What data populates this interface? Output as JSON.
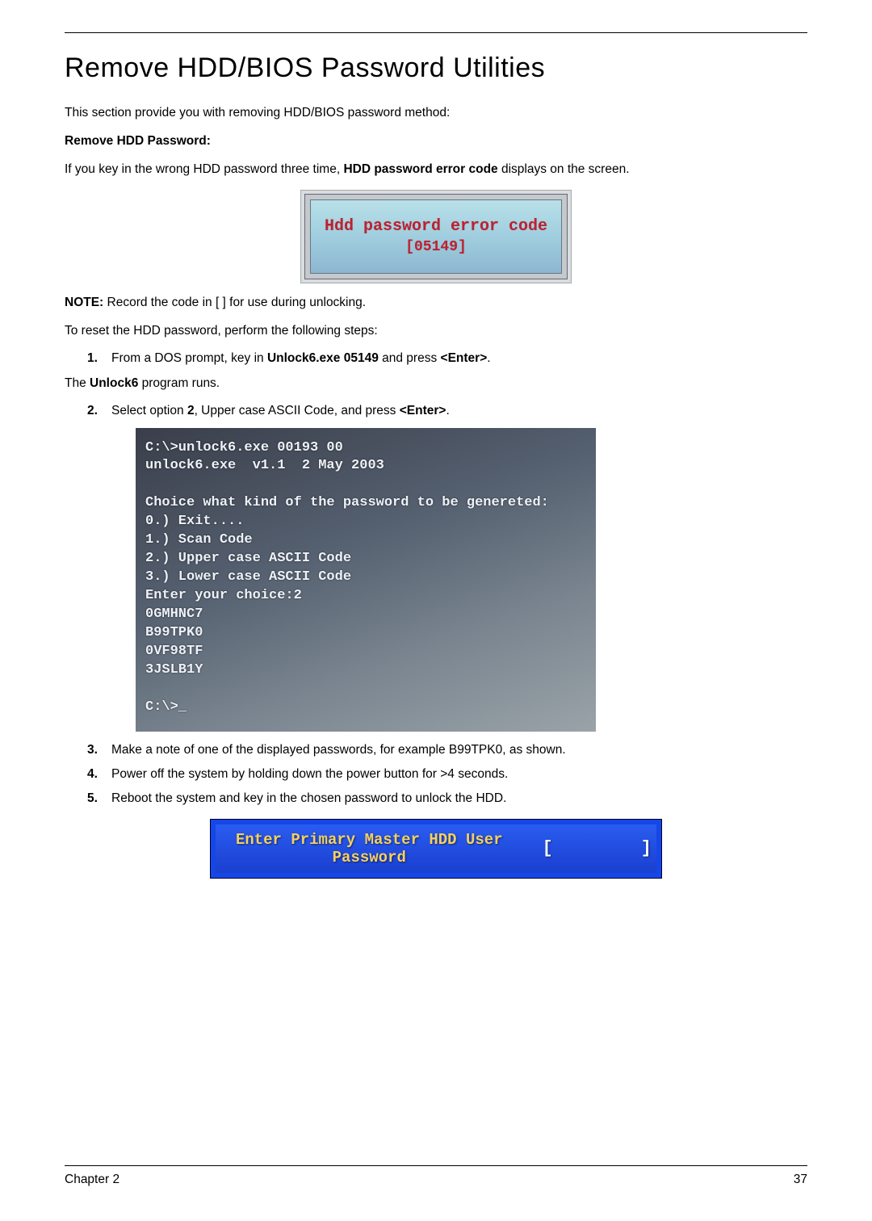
{
  "title": "Remove HDD/BIOS Password Utilities",
  "intro": "This section provide you with removing HDD/BIOS password method:",
  "sub_heading": "Remove HDD Password:",
  "wrong_pw_prefix": "If you key in the wrong HDD password three time, ",
  "wrong_pw_bold": "HDD password error code",
  "wrong_pw_suffix": " displays on the screen.",
  "error_box": {
    "line1": "Hdd password error code",
    "line2": "[05149]"
  },
  "note_label": "NOTE: ",
  "note_text": "Record the code in [  ] for use during unlocking.",
  "reset_intro": "To reset the HDD password, perform the following steps:",
  "step1": {
    "num": "1.",
    "prefix": "From a DOS prompt, key in ",
    "cmd": "Unlock6.exe 05149",
    "mid": " and press ",
    "enter": "<Enter>",
    "suffix": "."
  },
  "unlock_runs_prefix": "The ",
  "unlock_runs_bold": "Unlock6",
  "unlock_runs_suffix": " program runs.",
  "step2": {
    "num": "2.",
    "prefix": "Select option ",
    "opt": "2",
    "mid": ", Upper case ASCII Code, and press ",
    "enter": "<Enter>",
    "suffix": "."
  },
  "dos": {
    "l1": "C:\\>unlock6.exe 00193 00",
    "l2": "unlock6.exe  v1.1  2 May 2003",
    "l3": " ",
    "l4": "Choice what kind of the password to be genereted:",
    "l5": "0.) Exit....",
    "l6": "1.) Scan Code",
    "l7": "2.) Upper case ASCII Code",
    "l8": "3.) Lower case ASCII Code",
    "l9": "Enter your choice:2",
    "l10": "0GMHNC7",
    "l11": "B99TPK0",
    "l12": "0VF98TF",
    "l13": "3JSLB1Y",
    "l14": " ",
    "l15": "C:\\>_"
  },
  "step3": {
    "num": "3.",
    "text": "Make a note of one of the displayed passwords, for example B99TPK0, as shown."
  },
  "step4": {
    "num": "4.",
    "text": "Power off the system by holding down the power button for >4 seconds."
  },
  "step5": {
    "num": "5.",
    "text": " Reboot the system and key in the chosen password to unlock the HDD."
  },
  "pw_prompt": "Enter Primary Master HDD User Password",
  "footer": {
    "chapter": "Chapter 2",
    "page": "37"
  }
}
